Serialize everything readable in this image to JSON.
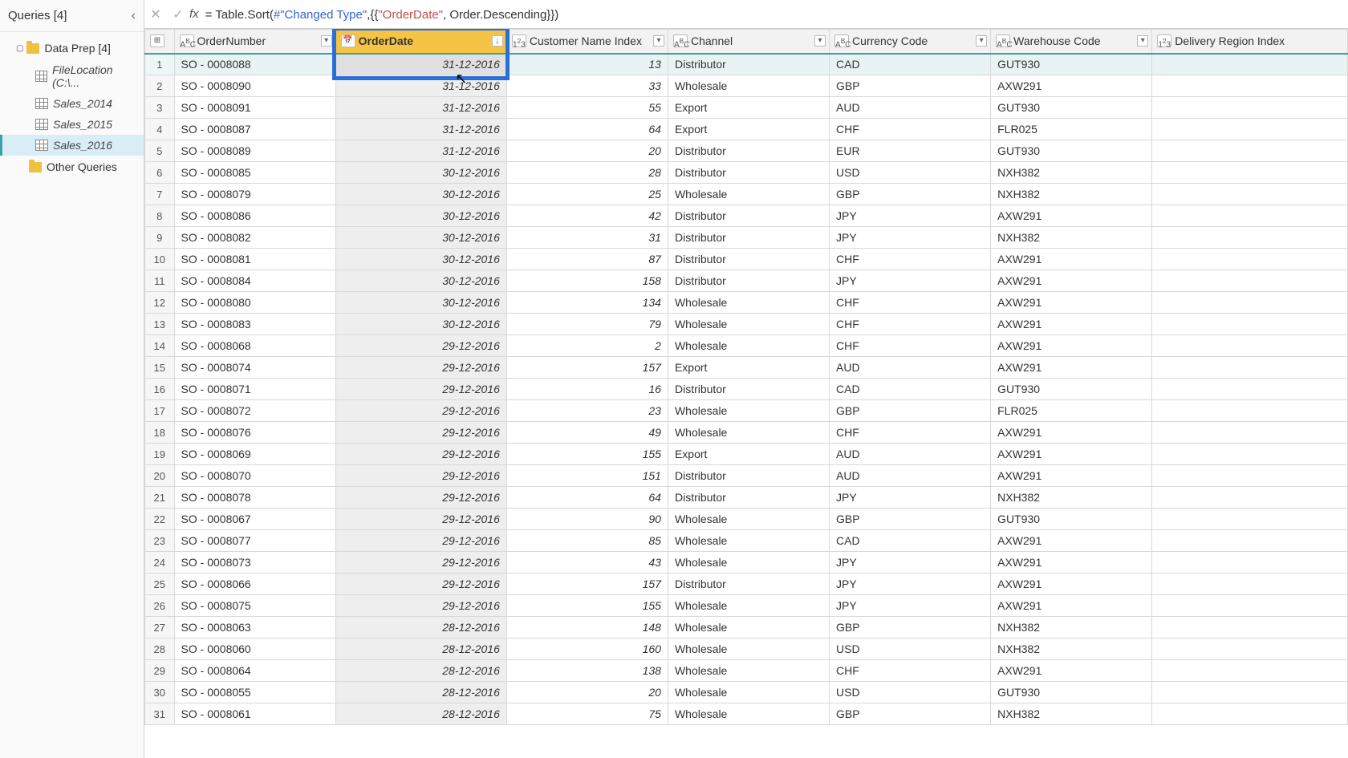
{
  "sidebar": {
    "title": "Queries [4]",
    "group": "Data Prep [4]",
    "items": [
      {
        "label": "FileLocation (C:\\...",
        "italic": true
      },
      {
        "label": "Sales_2014",
        "italic": true
      },
      {
        "label": "Sales_2015",
        "italic": true
      },
      {
        "label": "Sales_2016",
        "italic": true,
        "selected": true
      }
    ],
    "other": "Other Queries"
  },
  "formula": {
    "prefix": "= ",
    "fn": "Table.Sort",
    "arg1": "#\"Changed Type\"",
    "str": "\"OrderDate\"",
    "tail": ", Order.Descending}})"
  },
  "columns": [
    {
      "name": "OrderNumber",
      "type": "ABC"
    },
    {
      "name": "OrderDate",
      "type": "📅",
      "selected": true,
      "sort": "desc"
    },
    {
      "name": "Customer Name Index",
      "type": "123"
    },
    {
      "name": "Channel",
      "type": "ABC"
    },
    {
      "name": "Currency Code",
      "type": "ABC"
    },
    {
      "name": "Warehouse Code",
      "type": "ABC"
    },
    {
      "name": "Delivery Region Index",
      "type": "123"
    }
  ],
  "rows": [
    {
      "n": 1,
      "OrderNumber": "SO - 0008088",
      "OrderDate": "31-12-2016",
      "Customer": 13,
      "Channel": "Distributor",
      "Currency": "CAD",
      "Warehouse": "GUT930"
    },
    {
      "n": 2,
      "OrderNumber": "SO - 0008090",
      "OrderDate": "31-12-2016",
      "Customer": 33,
      "Channel": "Wholesale",
      "Currency": "GBP",
      "Warehouse": "AXW291"
    },
    {
      "n": 3,
      "OrderNumber": "SO - 0008091",
      "OrderDate": "31-12-2016",
      "Customer": 55,
      "Channel": "Export",
      "Currency": "AUD",
      "Warehouse": "GUT930"
    },
    {
      "n": 4,
      "OrderNumber": "SO - 0008087",
      "OrderDate": "31-12-2016",
      "Customer": 64,
      "Channel": "Export",
      "Currency": "CHF",
      "Warehouse": "FLR025"
    },
    {
      "n": 5,
      "OrderNumber": "SO - 0008089",
      "OrderDate": "31-12-2016",
      "Customer": 20,
      "Channel": "Distributor",
      "Currency": "EUR",
      "Warehouse": "GUT930"
    },
    {
      "n": 6,
      "OrderNumber": "SO - 0008085",
      "OrderDate": "30-12-2016",
      "Customer": 28,
      "Channel": "Distributor",
      "Currency": "USD",
      "Warehouse": "NXH382"
    },
    {
      "n": 7,
      "OrderNumber": "SO - 0008079",
      "OrderDate": "30-12-2016",
      "Customer": 25,
      "Channel": "Wholesale",
      "Currency": "GBP",
      "Warehouse": "NXH382"
    },
    {
      "n": 8,
      "OrderNumber": "SO - 0008086",
      "OrderDate": "30-12-2016",
      "Customer": 42,
      "Channel": "Distributor",
      "Currency": "JPY",
      "Warehouse": "AXW291"
    },
    {
      "n": 9,
      "OrderNumber": "SO - 0008082",
      "OrderDate": "30-12-2016",
      "Customer": 31,
      "Channel": "Distributor",
      "Currency": "JPY",
      "Warehouse": "NXH382"
    },
    {
      "n": 10,
      "OrderNumber": "SO - 0008081",
      "OrderDate": "30-12-2016",
      "Customer": 87,
      "Channel": "Distributor",
      "Currency": "CHF",
      "Warehouse": "AXW291"
    },
    {
      "n": 11,
      "OrderNumber": "SO - 0008084",
      "OrderDate": "30-12-2016",
      "Customer": 158,
      "Channel": "Distributor",
      "Currency": "JPY",
      "Warehouse": "AXW291"
    },
    {
      "n": 12,
      "OrderNumber": "SO - 0008080",
      "OrderDate": "30-12-2016",
      "Customer": 134,
      "Channel": "Wholesale",
      "Currency": "CHF",
      "Warehouse": "AXW291"
    },
    {
      "n": 13,
      "OrderNumber": "SO - 0008083",
      "OrderDate": "30-12-2016",
      "Customer": 79,
      "Channel": "Wholesale",
      "Currency": "CHF",
      "Warehouse": "AXW291"
    },
    {
      "n": 14,
      "OrderNumber": "SO - 0008068",
      "OrderDate": "29-12-2016",
      "Customer": 2,
      "Channel": "Wholesale",
      "Currency": "CHF",
      "Warehouse": "AXW291"
    },
    {
      "n": 15,
      "OrderNumber": "SO - 0008074",
      "OrderDate": "29-12-2016",
      "Customer": 157,
      "Channel": "Export",
      "Currency": "AUD",
      "Warehouse": "AXW291"
    },
    {
      "n": 16,
      "OrderNumber": "SO - 0008071",
      "OrderDate": "29-12-2016",
      "Customer": 16,
      "Channel": "Distributor",
      "Currency": "CAD",
      "Warehouse": "GUT930"
    },
    {
      "n": 17,
      "OrderNumber": "SO - 0008072",
      "OrderDate": "29-12-2016",
      "Customer": 23,
      "Channel": "Wholesale",
      "Currency": "GBP",
      "Warehouse": "FLR025"
    },
    {
      "n": 18,
      "OrderNumber": "SO - 0008076",
      "OrderDate": "29-12-2016",
      "Customer": 49,
      "Channel": "Wholesale",
      "Currency": "CHF",
      "Warehouse": "AXW291"
    },
    {
      "n": 19,
      "OrderNumber": "SO - 0008069",
      "OrderDate": "29-12-2016",
      "Customer": 155,
      "Channel": "Export",
      "Currency": "AUD",
      "Warehouse": "AXW291"
    },
    {
      "n": 20,
      "OrderNumber": "SO - 0008070",
      "OrderDate": "29-12-2016",
      "Customer": 151,
      "Channel": "Distributor",
      "Currency": "AUD",
      "Warehouse": "AXW291"
    },
    {
      "n": 21,
      "OrderNumber": "SO - 0008078",
      "OrderDate": "29-12-2016",
      "Customer": 64,
      "Channel": "Distributor",
      "Currency": "JPY",
      "Warehouse": "NXH382"
    },
    {
      "n": 22,
      "OrderNumber": "SO - 0008067",
      "OrderDate": "29-12-2016",
      "Customer": 90,
      "Channel": "Wholesale",
      "Currency": "GBP",
      "Warehouse": "GUT930"
    },
    {
      "n": 23,
      "OrderNumber": "SO - 0008077",
      "OrderDate": "29-12-2016",
      "Customer": 85,
      "Channel": "Wholesale",
      "Currency": "CAD",
      "Warehouse": "AXW291"
    },
    {
      "n": 24,
      "OrderNumber": "SO - 0008073",
      "OrderDate": "29-12-2016",
      "Customer": 43,
      "Channel": "Wholesale",
      "Currency": "JPY",
      "Warehouse": "AXW291"
    },
    {
      "n": 25,
      "OrderNumber": "SO - 0008066",
      "OrderDate": "29-12-2016",
      "Customer": 157,
      "Channel": "Distributor",
      "Currency": "JPY",
      "Warehouse": "AXW291"
    },
    {
      "n": 26,
      "OrderNumber": "SO - 0008075",
      "OrderDate": "29-12-2016",
      "Customer": 155,
      "Channel": "Wholesale",
      "Currency": "JPY",
      "Warehouse": "AXW291"
    },
    {
      "n": 27,
      "OrderNumber": "SO - 0008063",
      "OrderDate": "28-12-2016",
      "Customer": 148,
      "Channel": "Wholesale",
      "Currency": "GBP",
      "Warehouse": "NXH382"
    },
    {
      "n": 28,
      "OrderNumber": "SO - 0008060",
      "OrderDate": "28-12-2016",
      "Customer": 160,
      "Channel": "Wholesale",
      "Currency": "USD",
      "Warehouse": "NXH382"
    },
    {
      "n": 29,
      "OrderNumber": "SO - 0008064",
      "OrderDate": "28-12-2016",
      "Customer": 138,
      "Channel": "Wholesale",
      "Currency": "CHF",
      "Warehouse": "AXW291"
    },
    {
      "n": 30,
      "OrderNumber": "SO - 0008055",
      "OrderDate": "28-12-2016",
      "Customer": 20,
      "Channel": "Wholesale",
      "Currency": "USD",
      "Warehouse": "GUT930"
    },
    {
      "n": 31,
      "OrderNumber": "SO - 0008061",
      "OrderDate": "28-12-2016",
      "Customer": 75,
      "Channel": "Wholesale",
      "Currency": "GBP",
      "Warehouse": "NXH382"
    }
  ]
}
